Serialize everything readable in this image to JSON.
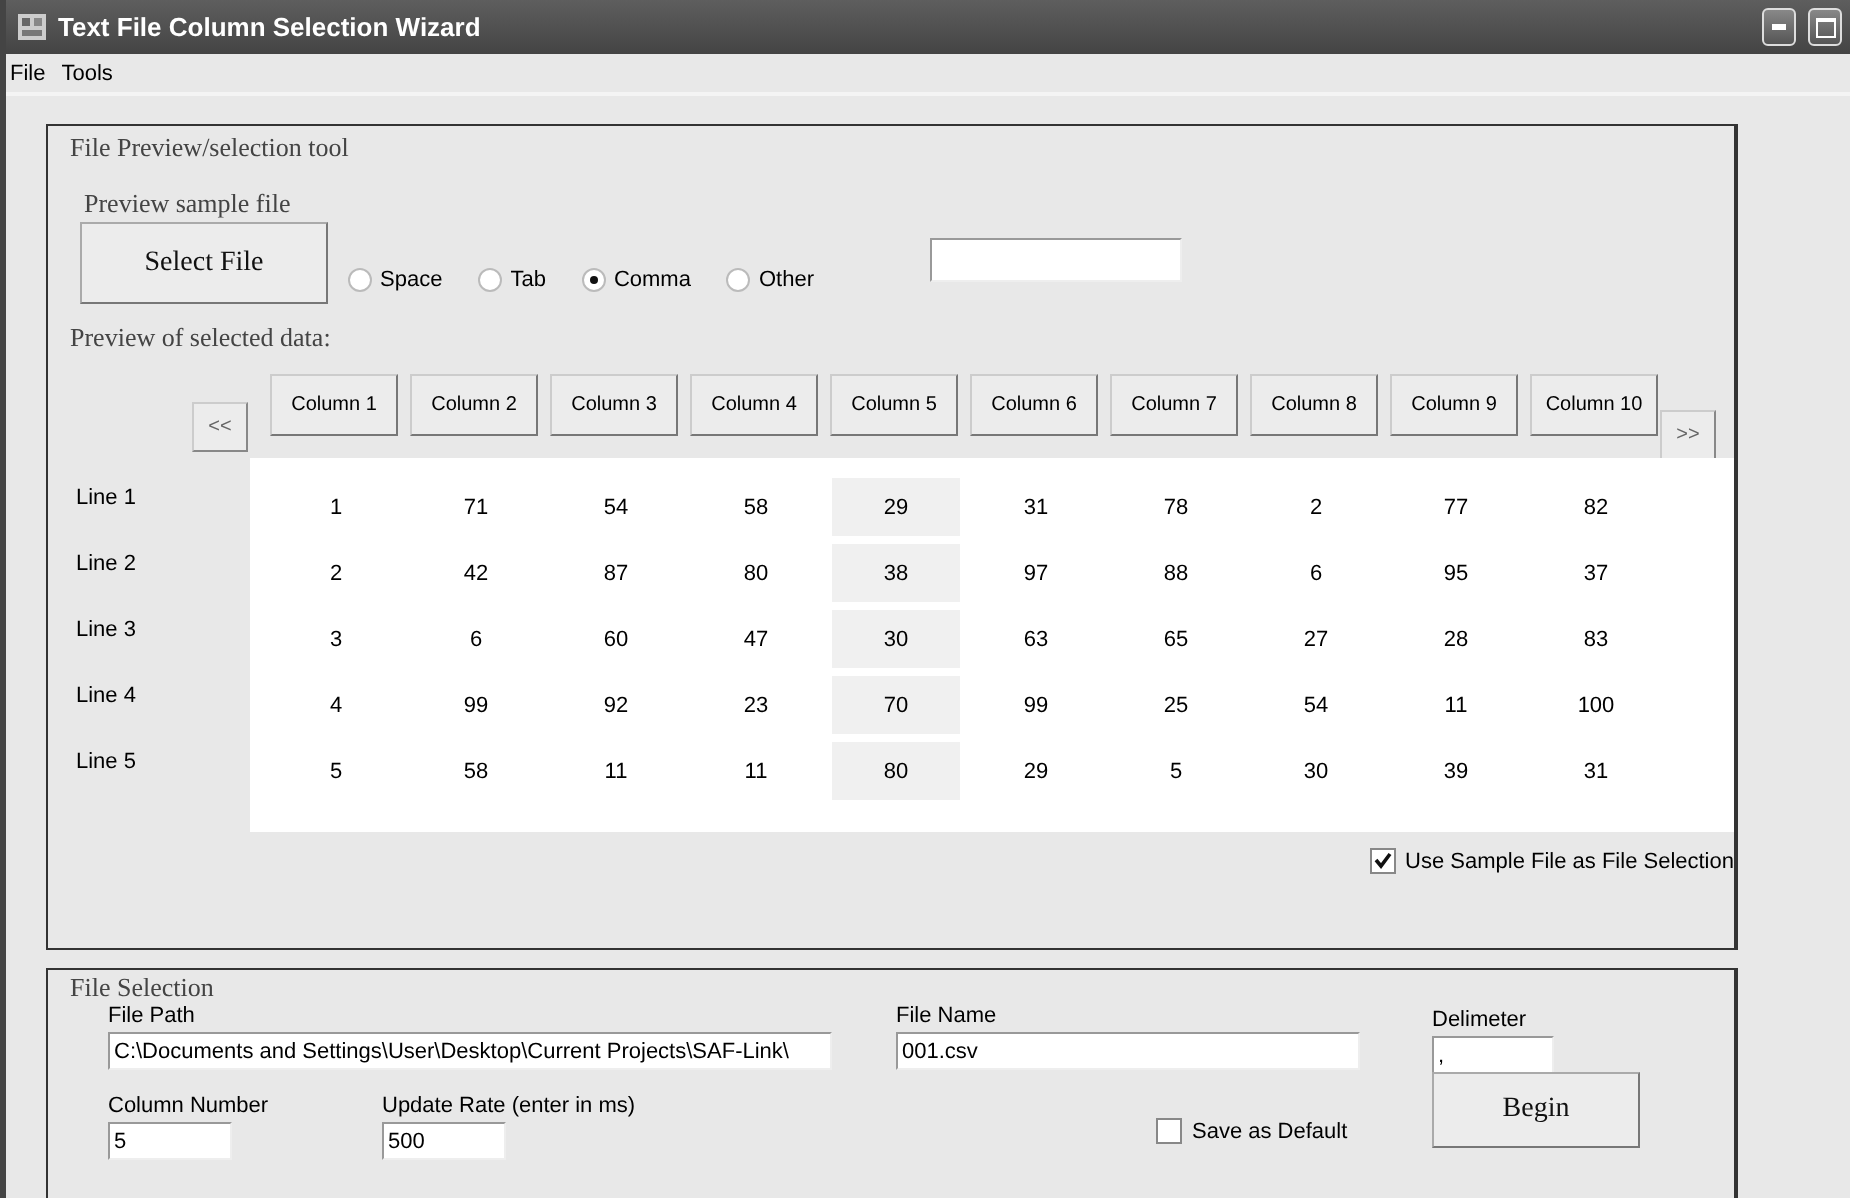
{
  "window": {
    "title": "Text File Column Selection Wizard"
  },
  "menu": [
    "File",
    "Tools"
  ],
  "preview_group": {
    "title": "File Preview/selection tool",
    "sample_label": "Preview sample file",
    "select_button": "Select File",
    "delimiters": [
      {
        "label": "Space",
        "selected": false
      },
      {
        "label": "Tab",
        "selected": false
      },
      {
        "label": "Comma",
        "selected": true
      },
      {
        "label": "Other",
        "selected": false
      }
    ],
    "data_label": "Preview of selected data:",
    "prev_button": "<<",
    "next_button": ">>",
    "columns": [
      {
        "label": "Column 1",
        "selected": false
      },
      {
        "label": "Column 2",
        "selected": false
      },
      {
        "label": "Column 3",
        "selected": false
      },
      {
        "label": "Column 4",
        "selected": false
      },
      {
        "label": "Column 5",
        "selected": true
      },
      {
        "label": "Column 6",
        "selected": false
      },
      {
        "label": "Column 7",
        "selected": false
      },
      {
        "label": "Column 8",
        "selected": false
      },
      {
        "label": "Column 9",
        "selected": false
      },
      {
        "label": "Column 10",
        "selected": false
      }
    ],
    "rows": [
      {
        "label": "Line 1",
        "cells": [
          "1",
          "71",
          "54",
          "58",
          "29",
          "31",
          "78",
          "2",
          "77",
          "82"
        ]
      },
      {
        "label": "Line 2",
        "cells": [
          "2",
          "42",
          "87",
          "80",
          "38",
          "97",
          "88",
          "6",
          "95",
          "37"
        ]
      },
      {
        "label": "Line 3",
        "cells": [
          "3",
          "6",
          "60",
          "47",
          "30",
          "63",
          "65",
          "27",
          "28",
          "83"
        ]
      },
      {
        "label": "Line 4",
        "cells": [
          "4",
          "99",
          "92",
          "23",
          "70",
          "99",
          "25",
          "54",
          "11",
          "100"
        ]
      },
      {
        "label": "Line 5",
        "cells": [
          "5",
          "58",
          "11",
          "11",
          "80",
          "29",
          "5",
          "30",
          "39",
          "31"
        ]
      }
    ],
    "use_sample": {
      "label": "Use Sample File as File Selection",
      "checked": true
    }
  },
  "file_selection": {
    "title": "File Selection",
    "file_path": {
      "label": "File Path",
      "value": "C:\\Documents and Settings\\User\\Desktop\\Current Projects\\SAF-Link\\"
    },
    "file_name": {
      "label": "File Name",
      "value": "001.csv"
    },
    "delimiter": {
      "label": "Delimeter",
      "value": ","
    },
    "column_number": {
      "label": "Column Number",
      "value": "5"
    },
    "update_rate": {
      "label": "Update Rate (enter in ms)",
      "value": "500"
    },
    "save_default": {
      "label": "Save as Default",
      "checked": false
    },
    "begin_button": "Begin"
  }
}
